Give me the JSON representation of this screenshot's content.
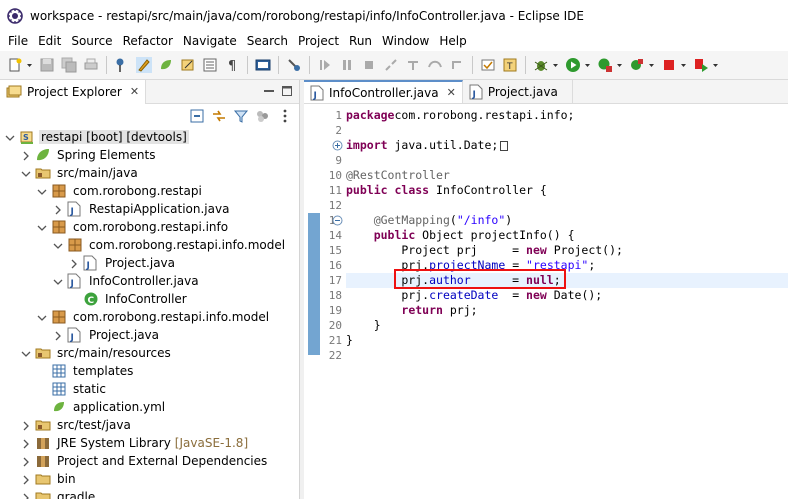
{
  "window": {
    "title": "workspace - restapi/src/main/java/com/rorobong/restapi/info/InfoController.java - Eclipse IDE"
  },
  "menu": [
    "File",
    "Edit",
    "Source",
    "Refactor",
    "Navigate",
    "Search",
    "Project",
    "Run",
    "Window",
    "Help"
  ],
  "explorer": {
    "title": "Project Explorer",
    "close": "✕",
    "tree": [
      {
        "label": "restapi [boot] [devtools]",
        "level": 0,
        "expanded": true,
        "icon": "project-icon",
        "selected": true
      },
      {
        "label": "Spring Elements",
        "level": 1,
        "expanded": false,
        "icon": "spring-leaf-icon"
      },
      {
        "label": "src/main/java",
        "level": 1,
        "expanded": true,
        "icon": "source-folder-icon"
      },
      {
        "label": "com.rorobong.restapi",
        "level": 2,
        "expanded": true,
        "icon": "package-icon"
      },
      {
        "label": "RestapiApplication.java",
        "level": 3,
        "expanded": false,
        "icon": "java-file-icon"
      },
      {
        "label": "com.rorobong.restapi.info",
        "level": 2,
        "expanded": true,
        "icon": "package-icon"
      },
      {
        "label": "com.rorobong.restapi.info.model",
        "level": 3,
        "expanded": true,
        "icon": "package-icon"
      },
      {
        "label": "Project.java",
        "level": 4,
        "expanded": false,
        "icon": "java-file-icon"
      },
      {
        "label": "InfoController.java",
        "level": 3,
        "expanded": true,
        "icon": "java-file-icon"
      },
      {
        "label": "InfoController",
        "level": 4,
        "leaf": true,
        "icon": "class-icon"
      },
      {
        "label": "com.rorobong.restapi.info.model",
        "level": 2,
        "expanded": true,
        "icon": "package-icon"
      },
      {
        "label": "Project.java",
        "level": 3,
        "expanded": false,
        "icon": "java-file-icon"
      },
      {
        "label": "src/main/resources",
        "level": 1,
        "expanded": true,
        "icon": "source-folder-icon"
      },
      {
        "label": "templates",
        "level": 2,
        "leaf": true,
        "icon": "folder-grid-icon"
      },
      {
        "label": "static",
        "level": 2,
        "leaf": true,
        "icon": "folder-grid-icon"
      },
      {
        "label": "application.yml",
        "level": 2,
        "leaf": true,
        "icon": "yml-file-icon"
      },
      {
        "label": "src/test/java",
        "level": 1,
        "expanded": false,
        "icon": "source-folder-icon"
      },
      {
        "label": "JRE System Library",
        "deco": "[JavaSE-1.8]",
        "level": 1,
        "expanded": false,
        "icon": "library-icon"
      },
      {
        "label": "Project and External Dependencies",
        "level": 1,
        "expanded": false,
        "icon": "library-icon"
      },
      {
        "label": "bin",
        "level": 1,
        "expanded": false,
        "icon": "folder-icon"
      },
      {
        "label": "gradle",
        "level": 1,
        "expanded": false,
        "icon": "folder-icon"
      }
    ]
  },
  "editor": {
    "tabs": [
      {
        "label": "InfoController.java",
        "active": true,
        "close": "✕"
      },
      {
        "label": "Project.java",
        "active": false
      }
    ],
    "lines": [
      {
        "n": "1",
        "tokens": [
          [
            "kw",
            "package"
          ],
          [
            "",
            "com.rorobong.restapi.info;"
          ]
        ]
      },
      {
        "n": "2",
        "tokens": []
      },
      {
        "n": "3",
        "fold": "plus",
        "tokens": [
          [
            "kw",
            "import"
          ],
          [
            "",
            " java.util.Date;"
          ]
        ],
        "foldbox": true
      },
      {
        "n": "9",
        "tokens": []
      },
      {
        "n": "10",
        "tokens": [
          [
            "an",
            "@RestController"
          ]
        ]
      },
      {
        "n": "11",
        "tokens": [
          [
            "kw",
            "public"
          ],
          [
            "",
            " "
          ],
          [
            "kw",
            "class"
          ],
          [
            "",
            " InfoController {"
          ]
        ]
      },
      {
        "n": "12",
        "tokens": []
      },
      {
        "n": "13",
        "fold": "minus",
        "tokens": [
          [
            "",
            "    "
          ],
          [
            "an",
            "@GetMapping"
          ],
          [
            "",
            "("
          ],
          [
            "st",
            "\"/info\""
          ],
          [
            "",
            ")"
          ]
        ]
      },
      {
        "n": "14",
        "tokens": [
          [
            "",
            "    "
          ],
          [
            "kw",
            "public"
          ],
          [
            "",
            " Object projectInfo() {"
          ]
        ]
      },
      {
        "n": "15",
        "tokens": [
          [
            "",
            "        Project prj     = "
          ],
          [
            "kw",
            "new"
          ],
          [
            "",
            " Project();"
          ]
        ]
      },
      {
        "n": "16",
        "tokens": [
          [
            "",
            "        prj."
          ],
          [
            "fd",
            "projectName"
          ],
          [
            "",
            " = "
          ],
          [
            "st",
            "\"restapi\""
          ],
          [
            "",
            ";"
          ]
        ]
      },
      {
        "n": "17",
        "current": true,
        "tokens": [
          [
            "",
            "        prj."
          ],
          [
            "fd",
            "author"
          ],
          [
            "",
            "      = "
          ],
          [
            "kw",
            "null"
          ],
          [
            "",
            ";"
          ]
        ]
      },
      {
        "n": "18",
        "tokens": [
          [
            "",
            "        prj."
          ],
          [
            "fd",
            "createDate"
          ],
          [
            "",
            "  = "
          ],
          [
            "kw",
            "new"
          ],
          [
            "",
            " Date();"
          ]
        ]
      },
      {
        "n": "19",
        "tokens": [
          [
            "",
            "        "
          ],
          [
            "kw",
            "return"
          ],
          [
            "",
            " prj;"
          ]
        ]
      },
      {
        "n": "20",
        "tokens": [
          [
            "",
            "    }"
          ]
        ]
      },
      {
        "n": "21",
        "tokens": [
          [
            "",
            "}"
          ]
        ]
      },
      {
        "n": "22",
        "tokens": []
      }
    ]
  }
}
